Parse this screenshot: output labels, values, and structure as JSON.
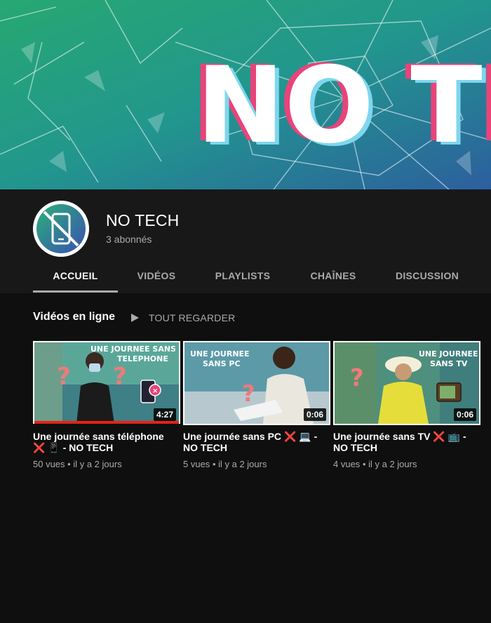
{
  "banner": {
    "text": "NO TECH",
    "colors": {
      "left": "#2aa877",
      "right": "#2f6ba8",
      "accent": "#e8447a",
      "glitch": "#7fd6ee"
    }
  },
  "channel": {
    "name": "NO TECH",
    "subscribers": "3 abonnés",
    "avatar_icon": "no-phone-icon"
  },
  "tabs": [
    {
      "label": "ACCUEIL",
      "active": true
    },
    {
      "label": "VIDÉOS"
    },
    {
      "label": "PLAYLISTS"
    },
    {
      "label": "CHAÎNES"
    },
    {
      "label": "DISCUSSION"
    }
  ],
  "shelf": {
    "title": "Vidéos en ligne",
    "play_all": "TOUT REGARDER"
  },
  "videos": [
    {
      "thumb_text": "UNE JOURNEE SANS TELEPHONE",
      "duration": "4:27",
      "watched_fraction": 1.0,
      "title_pre": "Une journée sans téléphone",
      "title_post": "- NO TECH",
      "emoji": "❌ 📱",
      "views": "50 vues",
      "age": "il y a 2 jours"
    },
    {
      "thumb_text_1": "UNE JOURNEE",
      "thumb_text_2": "SANS PC",
      "duration": "0:06",
      "title_pre": "Une journée sans PC",
      "title_post": "- NO TECH",
      "emoji": "❌ 💻",
      "views": "5 vues",
      "age": "il y a 2 jours"
    },
    {
      "thumb_text_1": "UNE JOURNEE",
      "thumb_text_2": "SANS TV",
      "duration": "0:06",
      "title_pre": "Une journée sans TV",
      "title_post": "- NO TECH",
      "emoji": "❌ 📺",
      "views": "4 vues",
      "age": "il y a 2 jours"
    }
  ]
}
